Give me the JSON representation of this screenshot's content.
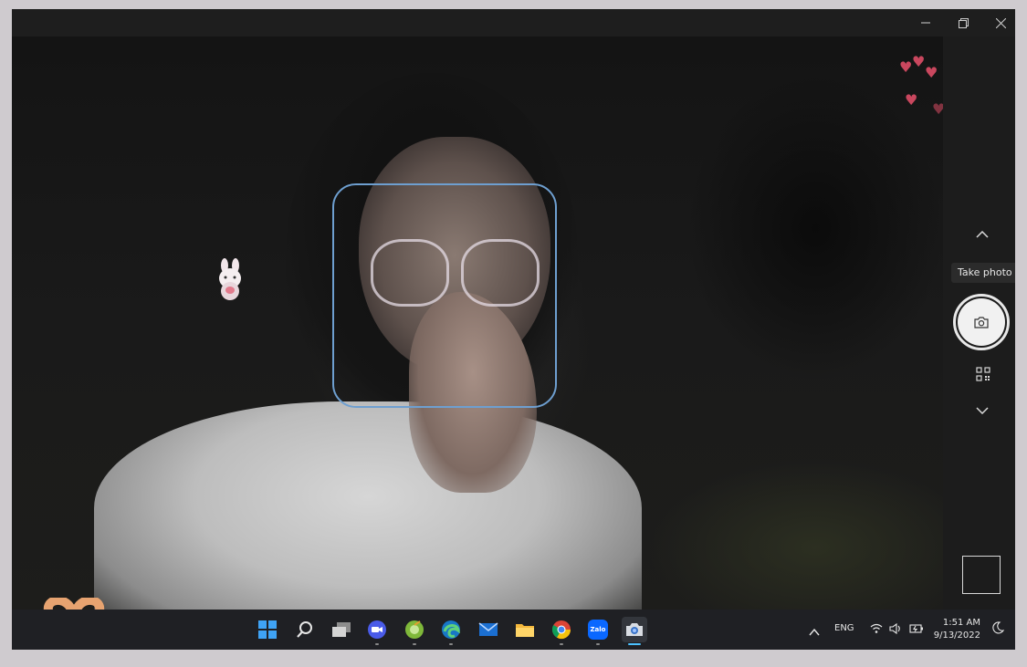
{
  "app": {
    "name": "Camera",
    "window_controls": [
      "minimize",
      "restore",
      "close"
    ]
  },
  "controls": {
    "tooltip": "Take photo",
    "up_icon": "chevron-up-icon",
    "down_icon": "chevron-down-icon",
    "shutter_icon": "camera-icon",
    "qr_icon": "qr-scan-icon"
  },
  "taskbar": {
    "apps": [
      "start",
      "search",
      "task-view",
      "zoom",
      "greenshot",
      "edge",
      "mail",
      "file-explorer",
      "chrome",
      "zalo",
      "camera"
    ],
    "zalo_label": "Zalo",
    "tray": {
      "language": "ENG",
      "time": "1:51 AM",
      "date": "9/13/2022"
    }
  },
  "colors": {
    "accent": "#4cc2ff",
    "face_box": "#6e9fd0",
    "taskbar_bg": "#1f2024"
  }
}
